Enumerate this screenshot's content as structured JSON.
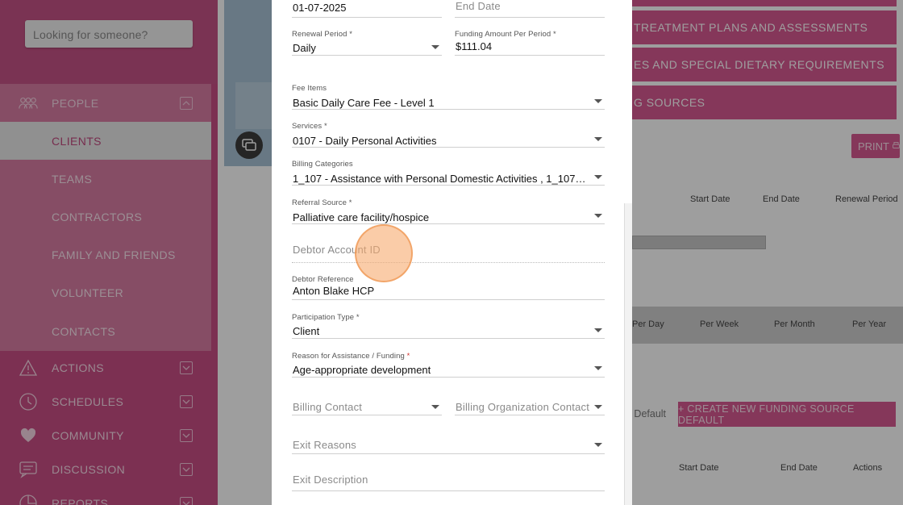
{
  "sidebar": {
    "search_placeholder": "Looking for someone?",
    "people": {
      "label": "PEOPLE"
    },
    "people_items": [
      {
        "label": "CLIENTS"
      },
      {
        "label": "TEAMS"
      },
      {
        "label": "CONTRACTORS"
      },
      {
        "label": "FAMILY AND FRIENDS"
      },
      {
        "label": "VOLUNTEER"
      },
      {
        "label": "CONTACTS"
      }
    ],
    "sections": [
      {
        "label": "ACTIONS",
        "icon": "warning-icon"
      },
      {
        "label": "SCHEDULES",
        "icon": "clock-icon"
      },
      {
        "label": "COMMUNITY",
        "icon": "hearts-icon"
      },
      {
        "label": "DISCUSSION",
        "icon": "chat-icon"
      },
      {
        "label": "REPORTS",
        "icon": "report-icon"
      }
    ]
  },
  "background": {
    "bars": [
      "TREATMENT PLANS AND ASSESSMENTS",
      "ES AND SPECIAL DIETARY REQUIREMENTS",
      "G SOURCES"
    ],
    "print_label": "PRINT",
    "table1_headers": [
      "Start Date",
      "End Date",
      "Renewal Period"
    ],
    "table2_headers": [
      "Per Day",
      "Per Week",
      "Per Month",
      "Per Year"
    ],
    "default_text": "e Default",
    "create_button": "+ CREATE NEW FUNDING SOURCE DEFAULT",
    "table3_headers": [
      "Start Date",
      "End Date",
      "Actions"
    ]
  },
  "form": {
    "start_date_value": "01-07-2025",
    "end_date_placeholder": "End Date",
    "renewal_period": {
      "label": "Renewal Period *",
      "value": "Daily"
    },
    "funding_amount": {
      "label": "Funding Amount Per Period *",
      "value": "$111.04"
    },
    "fee_items": {
      "label": "Fee Items",
      "value": "Basic Daily Care Fee - Level 1"
    },
    "services": {
      "label": "Services *",
      "value": "0107 - Daily Personal Activities"
    },
    "billing_categories": {
      "label": "Billing Categories",
      "value": "1_107 - Assistance with Personal Domestic Activities , 1_107 - Ass..."
    },
    "referral_source": {
      "label": "Referral Source *",
      "value": "Palliative care facility/hospice"
    },
    "debtor_account_id": {
      "placeholder": "Debtor Account ID"
    },
    "debtor_reference": {
      "label": "Debtor Reference",
      "value": "Anton Blake HCP"
    },
    "participation_type": {
      "label": "Participation Type *",
      "value": "Client"
    },
    "reason_for_assistance": {
      "label": "Reason for Assistance / Funding",
      "required_mark": "*",
      "value": "Age-appropriate development"
    },
    "billing_contact": {
      "placeholder": "Billing Contact"
    },
    "billing_org_contact": {
      "placeholder": "Billing Organization Contact"
    },
    "exit_reasons": {
      "placeholder": "Exit Reasons"
    },
    "exit_description": {
      "placeholder": "Exit Description"
    }
  }
}
